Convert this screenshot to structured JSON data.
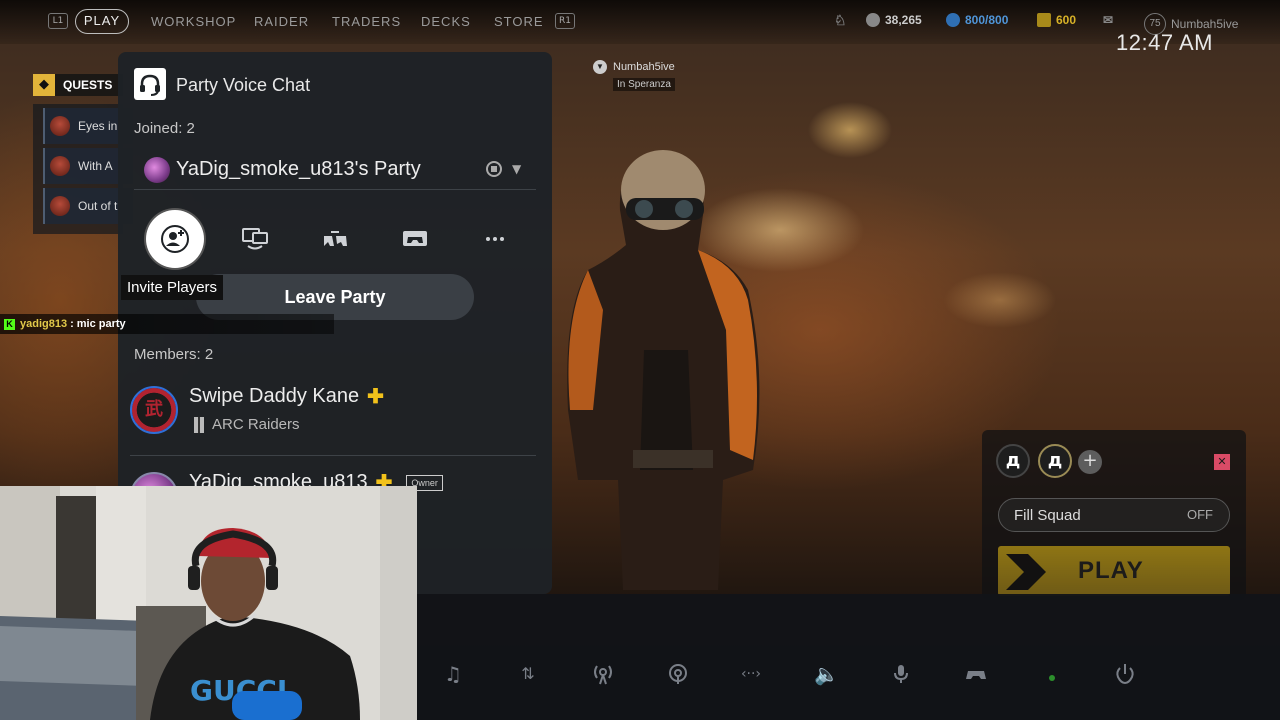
{
  "topnav": {
    "key_left": "L1",
    "items": [
      "PLAY",
      "WORKSHOP",
      "RAIDER",
      "TRADERS",
      "DECKS",
      "STORE"
    ],
    "key_right": "R1",
    "currency_1": "38,265",
    "currency_2": "800/800",
    "currency_3": "600",
    "level": "75",
    "username": "Numbah5ive"
  },
  "clock": "12:47 AM",
  "quests": {
    "title": "QUESTS",
    "items": [
      "Eyes in",
      "With A",
      "Out of t"
    ]
  },
  "chat": {
    "user": "yadig813",
    "separator": ":",
    "message": "mic party"
  },
  "player_tag": {
    "name": "Numbah5ive",
    "location": "In Speranza"
  },
  "squad": {
    "fill_label": "Fill Squad",
    "fill_value": "OFF",
    "play_label": "PLAY"
  },
  "party": {
    "title": "Party Voice Chat",
    "joined": "Joined: 2",
    "party_name": "YaDig_smoke_u813's Party",
    "tooltip": "Invite Players",
    "leave_label": "Leave Party",
    "members_label": "Members: 2",
    "members": [
      {
        "name": "Swipe Daddy Kane",
        "game": "ARC Raiders"
      },
      {
        "name": "YaDig_smoke_u813",
        "badge": "Owner"
      }
    ]
  },
  "colors": {
    "accent_yellow": "#f2c21b",
    "ps_plus": "#f2c21b",
    "ring_blue": "#2f6fd8"
  }
}
